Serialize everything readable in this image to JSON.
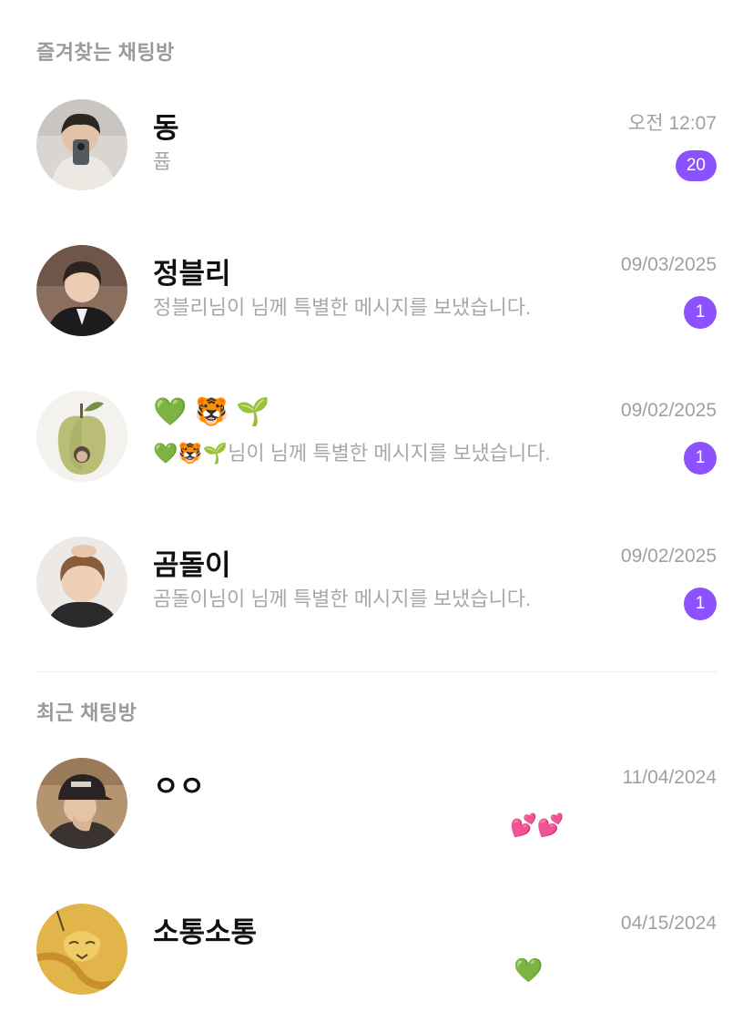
{
  "favorites": {
    "header": "즐겨찾는 채팅방",
    "chats": [
      {
        "name": "동",
        "preview": "퓹",
        "time": "오전 12:07",
        "unread": "20"
      },
      {
        "name": "정블리",
        "preview": "정블리님이        님께 특별한 메시지를 보냈습니다.",
        "time": "09/03/2025",
        "unread": "1"
      },
      {
        "name": "💚 🐯 🌱",
        "preview": "💚🐯🌱님이        님께 특별한 메시지를 보냈습니다.",
        "time": "09/02/2025",
        "unread": "1"
      },
      {
        "name": "곰돌이",
        "preview": "곰돌이님이        님께 특별한 메시지를 보냈습니다.",
        "time": "09/02/2025",
        "unread": "1"
      }
    ]
  },
  "recent": {
    "header": "최근 채팅방",
    "chats": [
      {
        "name": "ㅇㅇ",
        "preview": "💕💕",
        "time": "11/04/2024"
      },
      {
        "name": "소통소통",
        "preview": "💚",
        "time": "04/15/2024"
      }
    ]
  },
  "colors": {
    "accent": "#8c52ff",
    "muted_text": "#a8a8a8",
    "title_text": "#111111"
  }
}
